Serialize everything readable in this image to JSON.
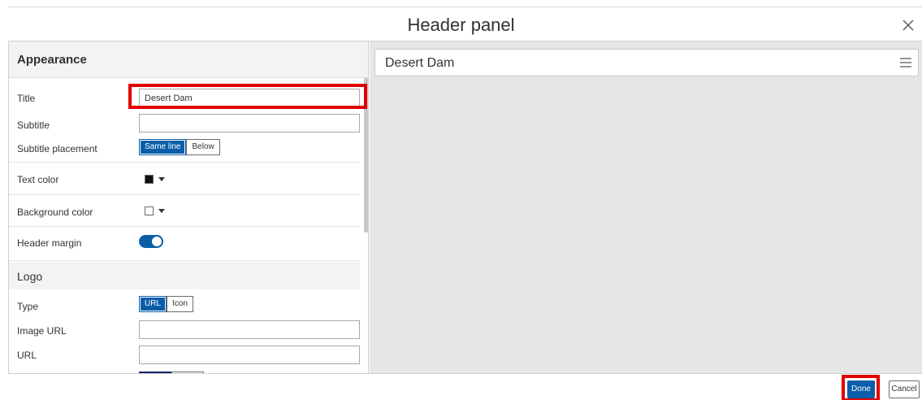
{
  "dialog": {
    "title": "Header panel",
    "close_icon": "close-icon"
  },
  "settings": {
    "appearance_heading": "Appearance",
    "title": {
      "label": "Title",
      "value": "Desert Dam"
    },
    "subtitle": {
      "label": "Subtitle",
      "value": ""
    },
    "subtitle_placement": {
      "label": "Subtitle placement",
      "options": [
        "Same line",
        "Below"
      ],
      "selected": "Same line"
    },
    "text_color": {
      "label": "Text color",
      "color": "#111111"
    },
    "background_color": {
      "label": "Background color",
      "color": "#ffffff"
    },
    "header_margin": {
      "label": "Header margin",
      "enabled": true
    },
    "logo_heading": "Logo",
    "type": {
      "label": "Type",
      "options": [
        "URL",
        "Icon"
      ],
      "selected": "URL"
    },
    "image_url": {
      "label": "Image URL",
      "value": ""
    },
    "url": {
      "label": "URL",
      "value": ""
    }
  },
  "preview": {
    "title": "Desert Dam",
    "menu_icon": "hamburger-menu-icon"
  },
  "footer": {
    "done_label": "Done",
    "cancel_label": "Cancel"
  },
  "colors": {
    "accent": "#0a5ea8",
    "highlight": "#e10000",
    "preview_bg": "#e6e6e6"
  }
}
